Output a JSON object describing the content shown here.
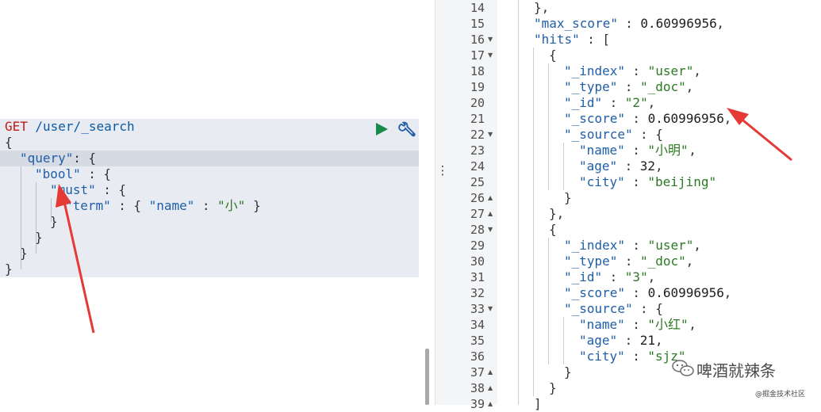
{
  "request": {
    "method": "GET",
    "path": "/user/_search",
    "lines": [
      {
        "indent": 0,
        "text": "{"
      },
      {
        "indent": 1,
        "key": "\"query\"",
        "sep": ": ",
        "tail": "{"
      },
      {
        "indent": 2,
        "key": "\"bool\"",
        "sep": " : ",
        "tail": "{"
      },
      {
        "indent": 3,
        "key": "\"must\"",
        "sep": " : ",
        "tail": "{"
      },
      {
        "indent": 4,
        "key": "\"term\"",
        "sep": " : ",
        "tail": "{ ",
        "key2": "\"name\"",
        "sep2": " : ",
        "val": "\"小\"",
        "end": " }"
      },
      {
        "indent": 3,
        "text": "}"
      },
      {
        "indent": 2,
        "text": "}"
      },
      {
        "indent": 1,
        "text": "}"
      },
      {
        "indent": 0,
        "text": "}"
      }
    ]
  },
  "icons": {
    "run": "play-icon",
    "wrench": "wrench-icon",
    "resize": "vertical-ellipsis-icon"
  },
  "resize_handle": "⋮",
  "response": {
    "lines": [
      {
        "n": "14",
        "fold": "",
        "indent": 2,
        "tail": "},"
      },
      {
        "n": "15",
        "fold": "",
        "indent": 2,
        "key": "\"max_score\"",
        "sep": " : ",
        "num": "0.60996956",
        "end": ","
      },
      {
        "n": "16",
        "fold": "▼",
        "indent": 2,
        "key": "\"hits\"",
        "sep": " : ",
        "tail": "["
      },
      {
        "n": "17",
        "fold": "▼",
        "indent": 3,
        "tail": "{"
      },
      {
        "n": "18",
        "fold": "",
        "indent": 4,
        "key": "\"_index\"",
        "sep": " : ",
        "str": "\"user\"",
        "end": ","
      },
      {
        "n": "19",
        "fold": "",
        "indent": 4,
        "key": "\"_type\"",
        "sep": " : ",
        "str": "\"_doc\"",
        "end": ","
      },
      {
        "n": "20",
        "fold": "",
        "indent": 4,
        "key": "\"_id\"",
        "sep": " : ",
        "str": "\"2\"",
        "end": ","
      },
      {
        "n": "21",
        "fold": "",
        "indent": 4,
        "key": "\"_score\"",
        "sep": " : ",
        "num": "0.60996956",
        "end": ","
      },
      {
        "n": "22",
        "fold": "▼",
        "indent": 4,
        "key": "\"_source\"",
        "sep": " : ",
        "tail": "{"
      },
      {
        "n": "23",
        "fold": "",
        "indent": 5,
        "key": "\"name\"",
        "sep": " : ",
        "str": "\"小明\"",
        "end": ","
      },
      {
        "n": "24",
        "fold": "",
        "indent": 5,
        "key": "\"age\"",
        "sep": " : ",
        "num": "32",
        "end": ","
      },
      {
        "n": "25",
        "fold": "",
        "indent": 5,
        "key": "\"city\"",
        "sep": " : ",
        "str": "\"beijing\"",
        "end": ""
      },
      {
        "n": "26",
        "fold": "▲",
        "indent": 4,
        "tail": "}"
      },
      {
        "n": "27",
        "fold": "▲",
        "indent": 3,
        "tail": "},"
      },
      {
        "n": "28",
        "fold": "▼",
        "indent": 3,
        "tail": "{"
      },
      {
        "n": "29",
        "fold": "",
        "indent": 4,
        "key": "\"_index\"",
        "sep": " : ",
        "str": "\"user\"",
        "end": ","
      },
      {
        "n": "30",
        "fold": "",
        "indent": 4,
        "key": "\"_type\"",
        "sep": " : ",
        "str": "\"_doc\"",
        "end": ","
      },
      {
        "n": "31",
        "fold": "",
        "indent": 4,
        "key": "\"_id\"",
        "sep": " : ",
        "str": "\"3\"",
        "end": ","
      },
      {
        "n": "32",
        "fold": "",
        "indent": 4,
        "key": "\"_score\"",
        "sep": " : ",
        "num": "0.60996956",
        "end": ","
      },
      {
        "n": "33",
        "fold": "▼",
        "indent": 4,
        "key": "\"_source\"",
        "sep": " : ",
        "tail": "{"
      },
      {
        "n": "34",
        "fold": "",
        "indent": 5,
        "key": "\"name\"",
        "sep": " : ",
        "str": "\"小红\"",
        "end": ","
      },
      {
        "n": "35",
        "fold": "",
        "indent": 5,
        "key": "\"age\"",
        "sep": " : ",
        "num": "21",
        "end": ","
      },
      {
        "n": "36",
        "fold": "",
        "indent": 5,
        "key": "\"city\"",
        "sep": " : ",
        "str": "\"sjz\"",
        "end": ""
      },
      {
        "n": "37",
        "fold": "▲",
        "indent": 4,
        "tail": "}"
      },
      {
        "n": "38",
        "fold": "▲",
        "indent": 3,
        "tail": "}"
      },
      {
        "n": "39",
        "fold": "▲",
        "indent": 2,
        "tail": "]"
      }
    ]
  },
  "watermark": {
    "title": "啤酒就辣条",
    "subtitle": "@掘金技术社区"
  },
  "colors": {
    "accent_run": "#1a8a4a",
    "wrench": "#1f5ea8",
    "annotation_arrow": "#e53935"
  }
}
